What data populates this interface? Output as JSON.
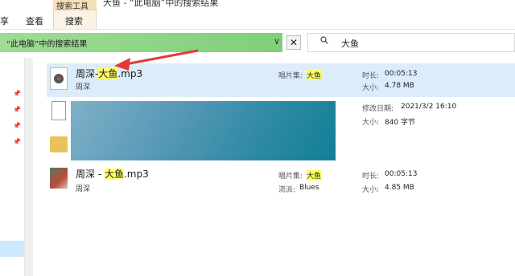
{
  "window": {
    "title": "大鱼 - “此电脑”中的搜索结果"
  },
  "ribbon": {
    "context_label": "搜索工具",
    "tabs": [
      {
        "label": "享"
      },
      {
        "label": "查看"
      },
      {
        "label": "搜索"
      }
    ]
  },
  "address": {
    "text": "“此电脑”中的搜索结果",
    "chevron": "∨",
    "close": "✕"
  },
  "search": {
    "value": "大鱼",
    "icon": "search-icon"
  },
  "results": [
    {
      "name_prefix": "周深-",
      "name_highlight": "大鱼",
      "name_suffix": ".mp3",
      "artist": "周深",
      "album_label": "唱片集:",
      "album_value": "大鱼",
      "duration_label": "时长:",
      "duration_value": "00:05:13",
      "size_label": "大小:",
      "size_value": "4.78 MB",
      "selected": true
    },
    {
      "date_label": "修改日期:",
      "date_value": "2021/3/2 16:10",
      "size_label": "大小:",
      "size_value": "840 字节"
    },
    {
      "name_prefix": "周深 - ",
      "name_highlight": "大鱼",
      "name_suffix": ".mp3",
      "artist": "周深",
      "album_label": "唱片集:",
      "album_value": "大鱼",
      "genre_label": "流派:",
      "genre_value": "Blues",
      "duration_label": "时长:",
      "duration_value": "00:05:13",
      "size_label": "大小:",
      "size_value": "4.85 MB"
    }
  ],
  "colors": {
    "highlight": "#ffff66",
    "selection": "#dcecfb",
    "address_progress": "#7fcf7a",
    "arrow": "#e53935"
  }
}
